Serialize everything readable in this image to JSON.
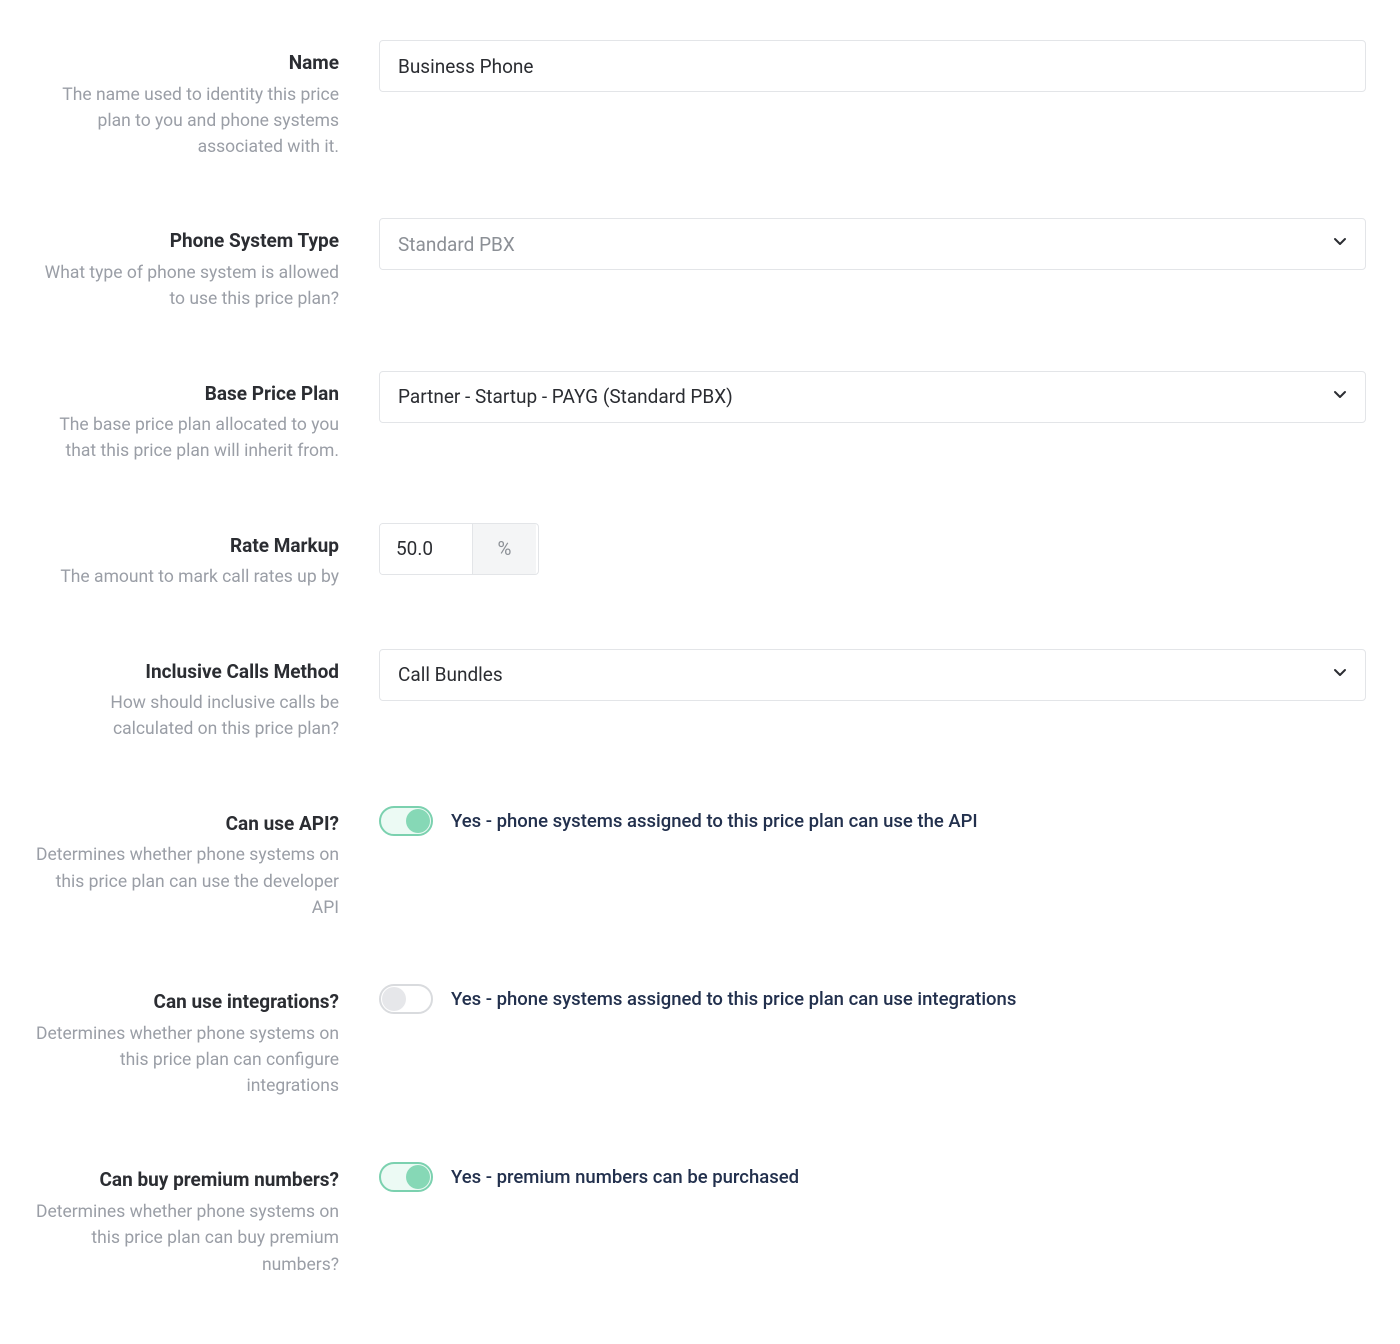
{
  "fields": {
    "name": {
      "label": "Name",
      "desc": "The name used to identity this price plan to you and phone systems associated with it.",
      "value": "Business Phone"
    },
    "phone_system_type": {
      "label": "Phone System Type",
      "desc": "What type of phone system is allowed to use this price plan?",
      "value": "Standard PBX"
    },
    "base_price_plan": {
      "label": "Base Price Plan",
      "desc": "The base price plan allocated to you that this price plan will inherit from.",
      "value": "Partner - Startup - PAYG (Standard PBX)"
    },
    "rate_markup": {
      "label": "Rate Markup",
      "desc": "The amount to mark call rates up by",
      "value": "50.0",
      "unit": "%"
    },
    "inclusive_calls": {
      "label": "Inclusive Calls Method",
      "desc": "How should inclusive calls be calculated on this price plan?",
      "value": "Call Bundles"
    },
    "can_use_api": {
      "label": "Can use API?",
      "desc": "Determines whether phone systems on this price plan can use the developer API",
      "on": true,
      "text": "Yes - phone systems assigned to this price plan can use the API"
    },
    "can_use_integrations": {
      "label": "Can use integrations?",
      "desc": "Determines whether phone systems on this price plan can configure integrations",
      "on": false,
      "text": "Yes - phone systems assigned to this price plan can use integrations"
    },
    "can_buy_premium": {
      "label": "Can buy premium numbers?",
      "desc": "Determines whether phone systems on this price plan can buy premium numbers?",
      "on": true,
      "text": "Yes - premium numbers can be purchased"
    }
  }
}
